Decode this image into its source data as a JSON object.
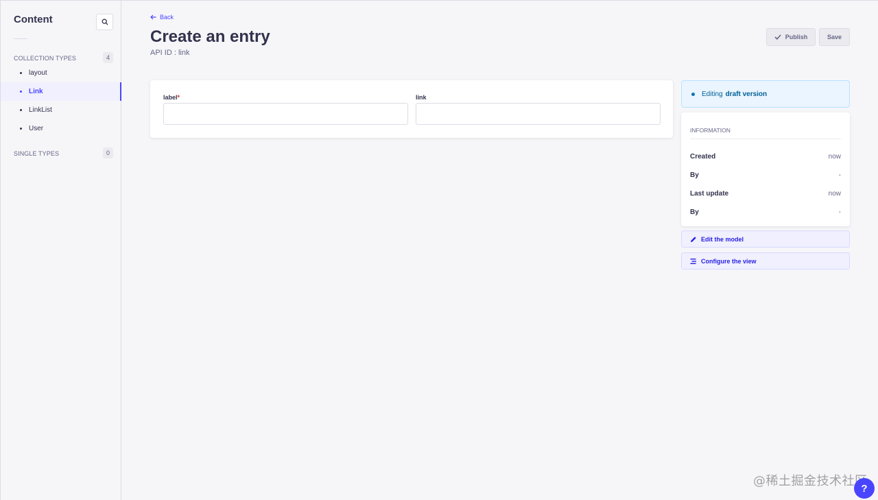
{
  "sidebar": {
    "title": "Content",
    "collection_types": {
      "label": "COLLECTION TYPES",
      "count": "4",
      "items": [
        {
          "label": "layout"
        },
        {
          "label": "Link"
        },
        {
          "label": "LinkList"
        },
        {
          "label": "User"
        }
      ],
      "active": "Link"
    },
    "single_types": {
      "label": "SINGLE TYPES",
      "count": "0"
    }
  },
  "header": {
    "back_label": "Back",
    "title": "Create an entry",
    "api_id": "API ID : link",
    "publish_label": "Publish",
    "save_label": "Save"
  },
  "form": {
    "fields": [
      {
        "label": "label",
        "required": "*",
        "value": ""
      },
      {
        "label": "link",
        "value": ""
      }
    ]
  },
  "status": {
    "prefix": "Editing",
    "strong": "draft version"
  },
  "information": {
    "title": "INFORMATION",
    "rows": [
      {
        "key": "Created",
        "value": "now"
      },
      {
        "key": "By",
        "value": "-"
      },
      {
        "key": "Last update",
        "value": "now"
      },
      {
        "key": "By",
        "value": "-"
      }
    ]
  },
  "actions": {
    "edit_model": "Edit the model",
    "configure_view": "Configure the view"
  },
  "watermark": "@稀土掘金技术社区",
  "help": "?",
  "colors": {
    "primary": "#4945ff",
    "background": "#f6f6f9",
    "draft_bg": "#eaf5ff"
  }
}
